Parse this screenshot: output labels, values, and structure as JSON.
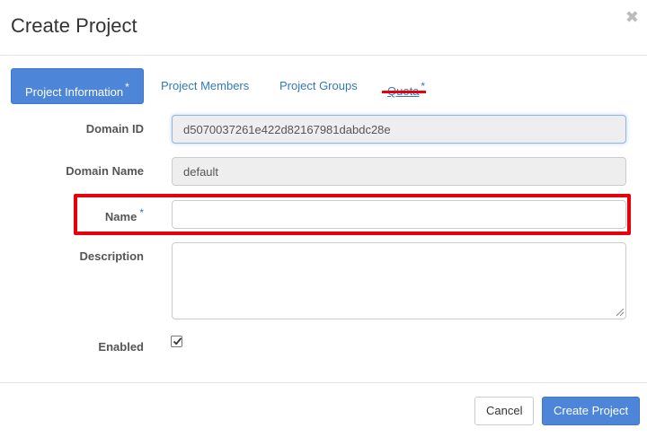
{
  "dialog": {
    "title": "Create Project",
    "close_glyph": "✖"
  },
  "tabs": [
    {
      "label": "Project Information",
      "required_marker": "*",
      "active": true
    },
    {
      "label": "Project Members",
      "required_marker": "",
      "active": false
    },
    {
      "label": "Project Groups",
      "required_marker": "",
      "active": false
    },
    {
      "label": "Quota",
      "required_marker": "*",
      "active": false
    }
  ],
  "form": {
    "domain_id": {
      "label": "Domain ID",
      "value": "d5070037261e422d82167981dabdc28e"
    },
    "domain_name": {
      "label": "Domain Name",
      "value": "default"
    },
    "name": {
      "label": "Name",
      "required_marker": "*",
      "value": "",
      "placeholder": ""
    },
    "description": {
      "label": "Description",
      "value": ""
    },
    "enabled": {
      "label": "Enabled",
      "checked": true
    }
  },
  "footer": {
    "cancel_label": "Cancel",
    "submit_label": "Create Project"
  },
  "colors": {
    "primary": "#4d86d8",
    "link": "#337ab7",
    "annotation_highlight": "#e8000b"
  },
  "icons": {
    "close": "close-icon",
    "checkbox_check": "check-icon"
  }
}
